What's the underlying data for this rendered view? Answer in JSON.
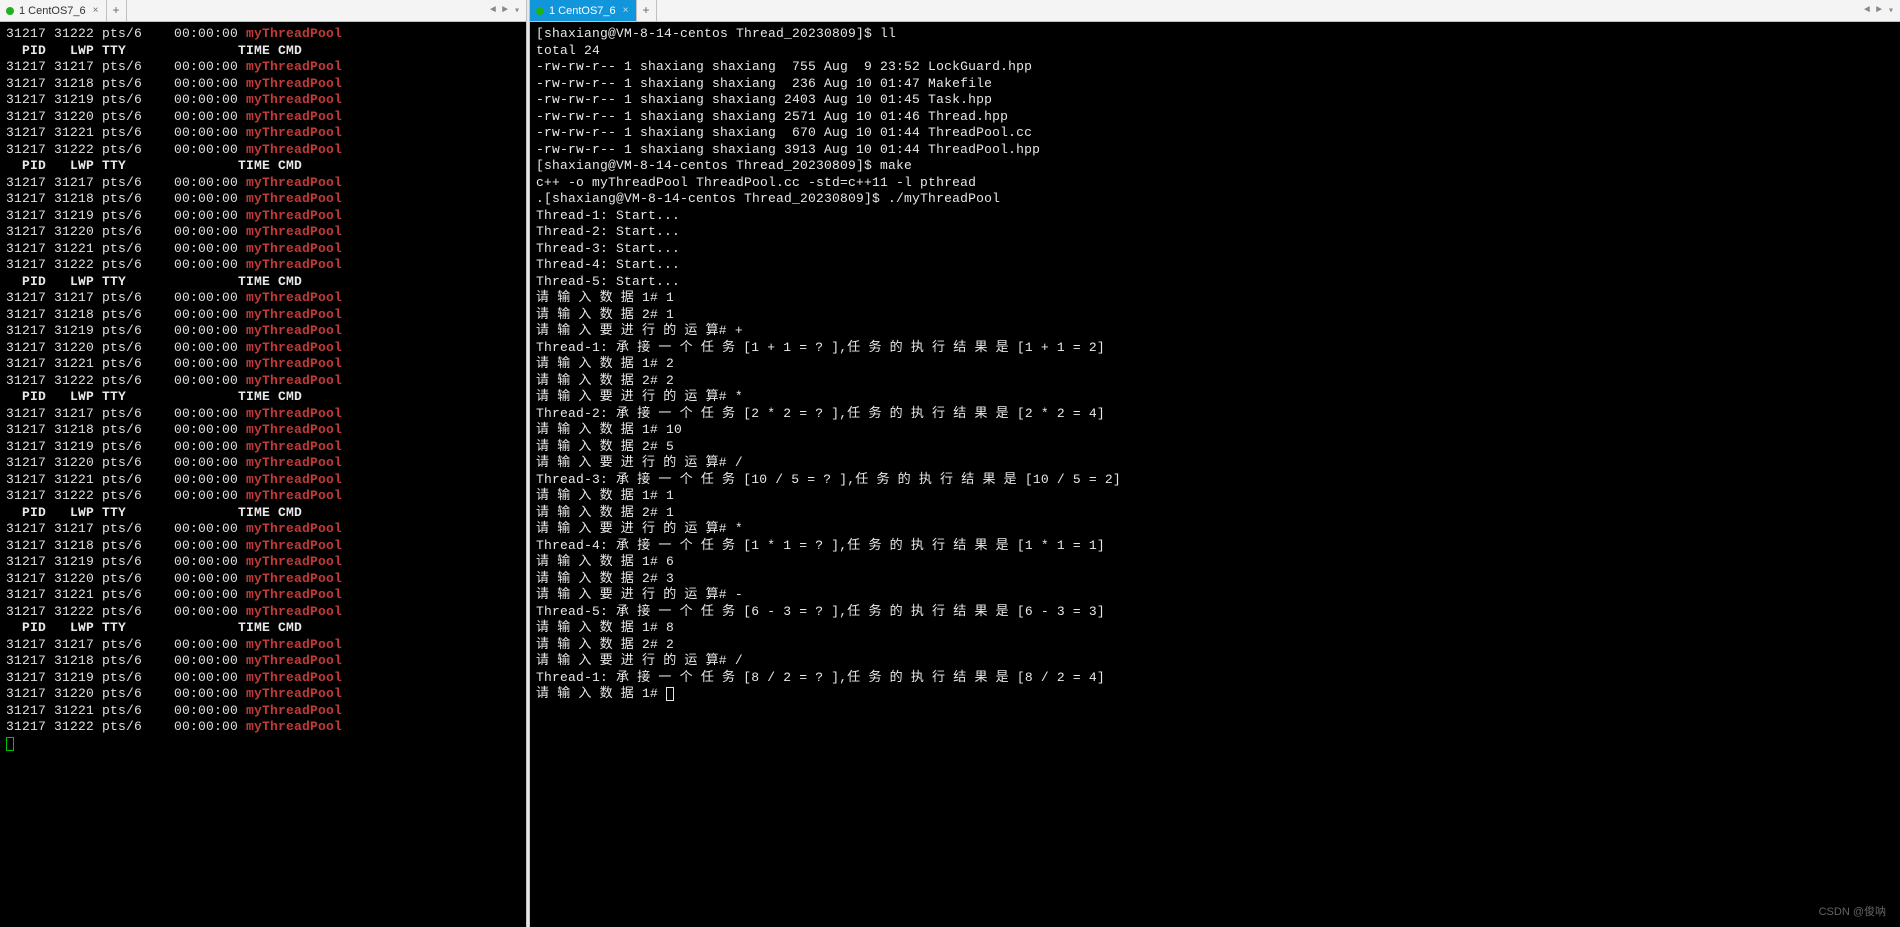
{
  "tabs": {
    "left": {
      "dot": true,
      "label": "1 CentOS7_6"
    },
    "right": {
      "dot": true,
      "label": "1 CentOS7_6"
    }
  },
  "left_lines": [
    {
      "t": "proc",
      "c": [
        "31217",
        "31222",
        "pts/6",
        "00:00:00",
        "myThreadPool"
      ]
    },
    {
      "t": "head",
      "c": [
        "  PID",
        "  LWP",
        "TTY",
        "    TIME",
        "CMD"
      ]
    },
    {
      "t": "proc",
      "c": [
        "31217",
        "31217",
        "pts/6",
        "00:00:00",
        "myThreadPool"
      ]
    },
    {
      "t": "proc",
      "c": [
        "31217",
        "31218",
        "pts/6",
        "00:00:00",
        "myThreadPool"
      ]
    },
    {
      "t": "proc",
      "c": [
        "31217",
        "31219",
        "pts/6",
        "00:00:00",
        "myThreadPool"
      ]
    },
    {
      "t": "proc",
      "c": [
        "31217",
        "31220",
        "pts/6",
        "00:00:00",
        "myThreadPool"
      ]
    },
    {
      "t": "proc",
      "c": [
        "31217",
        "31221",
        "pts/6",
        "00:00:00",
        "myThreadPool"
      ]
    },
    {
      "t": "proc",
      "c": [
        "31217",
        "31222",
        "pts/6",
        "00:00:00",
        "myThreadPool"
      ]
    },
    {
      "t": "head",
      "c": [
        "  PID",
        "  LWP",
        "TTY",
        "    TIME",
        "CMD"
      ]
    },
    {
      "t": "proc",
      "c": [
        "31217",
        "31217",
        "pts/6",
        "00:00:00",
        "myThreadPool"
      ]
    },
    {
      "t": "proc",
      "c": [
        "31217",
        "31218",
        "pts/6",
        "00:00:00",
        "myThreadPool"
      ]
    },
    {
      "t": "proc",
      "c": [
        "31217",
        "31219",
        "pts/6",
        "00:00:00",
        "myThreadPool"
      ]
    },
    {
      "t": "proc",
      "c": [
        "31217",
        "31220",
        "pts/6",
        "00:00:00",
        "myThreadPool"
      ]
    },
    {
      "t": "proc",
      "c": [
        "31217",
        "31221",
        "pts/6",
        "00:00:00",
        "myThreadPool"
      ]
    },
    {
      "t": "proc",
      "c": [
        "31217",
        "31222",
        "pts/6",
        "00:00:00",
        "myThreadPool"
      ]
    },
    {
      "t": "head",
      "c": [
        "  PID",
        "  LWP",
        "TTY",
        "    TIME",
        "CMD"
      ]
    },
    {
      "t": "proc",
      "c": [
        "31217",
        "31217",
        "pts/6",
        "00:00:00",
        "myThreadPool"
      ]
    },
    {
      "t": "proc",
      "c": [
        "31217",
        "31218",
        "pts/6",
        "00:00:00",
        "myThreadPool"
      ]
    },
    {
      "t": "proc",
      "c": [
        "31217",
        "31219",
        "pts/6",
        "00:00:00",
        "myThreadPool"
      ]
    },
    {
      "t": "proc",
      "c": [
        "31217",
        "31220",
        "pts/6",
        "00:00:00",
        "myThreadPool"
      ]
    },
    {
      "t": "proc",
      "c": [
        "31217",
        "31221",
        "pts/6",
        "00:00:00",
        "myThreadPool"
      ]
    },
    {
      "t": "proc",
      "c": [
        "31217",
        "31222",
        "pts/6",
        "00:00:00",
        "myThreadPool"
      ]
    },
    {
      "t": "head",
      "c": [
        "  PID",
        "  LWP",
        "TTY",
        "    TIME",
        "CMD"
      ]
    },
    {
      "t": "proc",
      "c": [
        "31217",
        "31217",
        "pts/6",
        "00:00:00",
        "myThreadPool"
      ]
    },
    {
      "t": "proc",
      "c": [
        "31217",
        "31218",
        "pts/6",
        "00:00:00",
        "myThreadPool"
      ]
    },
    {
      "t": "proc",
      "c": [
        "31217",
        "31219",
        "pts/6",
        "00:00:00",
        "myThreadPool"
      ]
    },
    {
      "t": "proc",
      "c": [
        "31217",
        "31220",
        "pts/6",
        "00:00:00",
        "myThreadPool"
      ]
    },
    {
      "t": "proc",
      "c": [
        "31217",
        "31221",
        "pts/6",
        "00:00:00",
        "myThreadPool"
      ]
    },
    {
      "t": "proc",
      "c": [
        "31217",
        "31222",
        "pts/6",
        "00:00:00",
        "myThreadPool"
      ]
    },
    {
      "t": "head",
      "c": [
        "  PID",
        "  LWP",
        "TTY",
        "    TIME",
        "CMD"
      ]
    },
    {
      "t": "proc",
      "c": [
        "31217",
        "31217",
        "pts/6",
        "00:00:00",
        "myThreadPool"
      ]
    },
    {
      "t": "proc",
      "c": [
        "31217",
        "31218",
        "pts/6",
        "00:00:00",
        "myThreadPool"
      ]
    },
    {
      "t": "proc",
      "c": [
        "31217",
        "31219",
        "pts/6",
        "00:00:00",
        "myThreadPool"
      ]
    },
    {
      "t": "proc",
      "c": [
        "31217",
        "31220",
        "pts/6",
        "00:00:00",
        "myThreadPool"
      ]
    },
    {
      "t": "proc",
      "c": [
        "31217",
        "31221",
        "pts/6",
        "00:00:00",
        "myThreadPool"
      ]
    },
    {
      "t": "proc",
      "c": [
        "31217",
        "31222",
        "pts/6",
        "00:00:00",
        "myThreadPool"
      ]
    },
    {
      "t": "head",
      "c": [
        "  PID",
        "  LWP",
        "TTY",
        "    TIME",
        "CMD"
      ]
    },
    {
      "t": "proc",
      "c": [
        "31217",
        "31217",
        "pts/6",
        "00:00:00",
        "myThreadPool"
      ]
    },
    {
      "t": "proc",
      "c": [
        "31217",
        "31218",
        "pts/6",
        "00:00:00",
        "myThreadPool"
      ]
    },
    {
      "t": "proc",
      "c": [
        "31217",
        "31219",
        "pts/6",
        "00:00:00",
        "myThreadPool"
      ]
    },
    {
      "t": "proc",
      "c": [
        "31217",
        "31220",
        "pts/6",
        "00:00:00",
        "myThreadPool"
      ]
    },
    {
      "t": "proc",
      "c": [
        "31217",
        "31221",
        "pts/6",
        "00:00:00",
        "myThreadPool"
      ]
    },
    {
      "t": "proc",
      "c": [
        "31217",
        "31222",
        "pts/6",
        "00:00:00",
        "myThreadPool"
      ]
    }
  ],
  "right_lines": [
    "[shaxiang@VM-8-14-centos Thread_20230809]$ ll",
    "total 24",
    "-rw-rw-r-- 1 shaxiang shaxiang  755 Aug  9 23:52 LockGuard.hpp",
    "-rw-rw-r-- 1 shaxiang shaxiang  236 Aug 10 01:47 Makefile",
    "-rw-rw-r-- 1 shaxiang shaxiang 2403 Aug 10 01:45 Task.hpp",
    "-rw-rw-r-- 1 shaxiang shaxiang 2571 Aug 10 01:46 Thread.hpp",
    "-rw-rw-r-- 1 shaxiang shaxiang  670 Aug 10 01:44 ThreadPool.cc",
    "-rw-rw-r-- 1 shaxiang shaxiang 3913 Aug 10 01:44 ThreadPool.hpp",
    "[shaxiang@VM-8-14-centos Thread_20230809]$ make",
    "c++ -o myThreadPool ThreadPool.cc -std=c++11 -l pthread",
    ".[shaxiang@VM-8-14-centos Thread_20230809]$ ./myThreadPool",
    "Thread-1: Start...",
    "Thread-2: Start...",
    "Thread-3: Start...",
    "Thread-4: Start...",
    "Thread-5: Start...",
    "请 输 入 数 据 1# 1",
    "请 输 入 数 据 2# 1",
    "请 输 入 要 进 行 的 运 算# +",
    "Thread-1: 承 接 一 个 任 务 [1 + 1 = ? ],任 务 的 执 行 结 果 是 [1 + 1 = 2]",
    "请 输 入 数 据 1# 2",
    "请 输 入 数 据 2# 2",
    "请 输 入 要 进 行 的 运 算# *",
    "Thread-2: 承 接 一 个 任 务 [2 * 2 = ? ],任 务 的 执 行 结 果 是 [2 * 2 = 4]",
    "请 输 入 数 据 1# 10",
    "请 输 入 数 据 2# 5",
    "请 输 入 要 进 行 的 运 算# /",
    "Thread-3: 承 接 一 个 任 务 [10 / 5 = ? ],任 务 的 执 行 结 果 是 [10 / 5 = 2]",
    "请 输 入 数 据 1# 1",
    "请 输 入 数 据 2# 1",
    "请 输 入 要 进 行 的 运 算# *",
    "Thread-4: 承 接 一 个 任 务 [1 * 1 = ? ],任 务 的 执 行 结 果 是 [1 * 1 = 1]",
    "请 输 入 数 据 1# 6",
    "请 输 入 数 据 2# 3",
    "请 输 入 要 进 行 的 运 算# -",
    "Thread-5: 承 接 一 个 任 务 [6 - 3 = ? ],任 务 的 执 行 结 果 是 [6 - 3 = 3]",
    "请 输 入 数 据 1# 8",
    "请 输 入 数 据 2# 2",
    "请 输 入 要 进 行 的 运 算# /",
    "Thread-1: 承 接 一 个 任 务 [8 / 2 = ? ],任 务 的 执 行 结 果 是 [8 / 2 = 4]",
    "请 输 入 数 据 1# "
  ],
  "watermark": "CSDN @俊呐"
}
